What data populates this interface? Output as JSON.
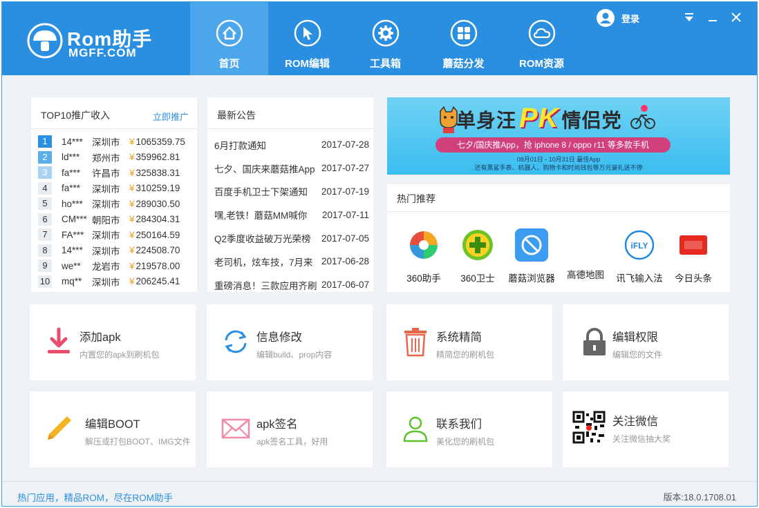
{
  "header": {
    "logo_text": "Rom助手",
    "logo_sub": "MGFF.COM",
    "nav": [
      {
        "label": "首页",
        "icon": "home-icon",
        "active": true
      },
      {
        "label": "ROM编辑",
        "icon": "cursor-icon",
        "active": false
      },
      {
        "label": "工具箱",
        "icon": "gear-icon",
        "active": false
      },
      {
        "label": "蘑菇分发",
        "icon": "grid-icon",
        "active": false
      },
      {
        "label": "ROM资源",
        "icon": "cloud-icon",
        "active": false
      }
    ],
    "login_label": "登录"
  },
  "top10": {
    "title": "TOP10推广收入",
    "link": "立即推广",
    "rows": [
      {
        "rank": "1",
        "user": "14***",
        "city": "深圳市",
        "amount": "1065359.75"
      },
      {
        "rank": "2",
        "user": "ld***",
        "city": "郑州市",
        "amount": "359962.81"
      },
      {
        "rank": "3",
        "user": "fa***",
        "city": "许昌市",
        "amount": "325838.31"
      },
      {
        "rank": "4",
        "user": "fa***",
        "city": "深圳市",
        "amount": "310259.19"
      },
      {
        "rank": "5",
        "user": "ho***",
        "city": "深圳市",
        "amount": "289030.50"
      },
      {
        "rank": "6",
        "user": "CM***",
        "city": "朝阳市",
        "amount": "284304.31"
      },
      {
        "rank": "7",
        "user": "FA***",
        "city": "深圳市",
        "amount": "250164.59"
      },
      {
        "rank": "8",
        "user": "14***",
        "city": "深圳市",
        "amount": "224508.70"
      },
      {
        "rank": "9",
        "user": "we**",
        "city": "龙岩市",
        "amount": "219578.00"
      },
      {
        "rank": "10",
        "user": "mq**",
        "city": "深圳市",
        "amount": "206245.41"
      }
    ],
    "currency": "¥"
  },
  "notices": {
    "title": "最新公告",
    "rows": [
      {
        "title": "6月打款通知",
        "date": "2017-07-28"
      },
      {
        "title": "七夕、国庆来蘑菇推App",
        "date": "2017-07-27"
      },
      {
        "title": "百度手机卫士下架通知",
        "date": "2017-07-19"
      },
      {
        "title": "嘿,老铁！蘑菇MM喊你",
        "date": "2017-07-11"
      },
      {
        "title": "Q2季度收益破万光荣榜",
        "date": "2017-07-05"
      },
      {
        "title": "老司机，炫车技，7月来",
        "date": "2017-06-28"
      },
      {
        "title": "重磅消息！三款应用齐刷",
        "date": "2017-06-07"
      }
    ]
  },
  "banner": {
    "title_left": "单身汪",
    "title_pk": "PK",
    "title_right": "情侣党",
    "strip": "七夕/国庆推App，抢 iphone 8 / oppo r11 等多款手机",
    "sub_line1": "08月01日 - 10月31日  最佳App",
    "sub_line2": "还有黑鲨手表、机器人、购物卡和时尚钱包等万元豪礼送不停"
  },
  "hot": {
    "title": "热门推荐",
    "apps": [
      {
        "label": "360助手",
        "icon": "360-assistant-icon"
      },
      {
        "label": "360卫士",
        "icon": "360-guard-icon"
      },
      {
        "label": "蘑菇浏览器",
        "icon": "mogu-browser-icon"
      },
      {
        "label": "高德地图",
        "icon": "amap-icon"
      },
      {
        "label": "讯飞输入法",
        "icon": "ifly-icon"
      },
      {
        "label": "今日头条",
        "icon": "toutiao-icon"
      }
    ]
  },
  "tiles": [
    {
      "title": "添加apk",
      "desc": "内置您的apk到刷机包",
      "icon": "download-icon"
    },
    {
      "title": "信息修改",
      "desc": "编辑build、prop内容",
      "icon": "refresh-icon"
    },
    {
      "title": "系统精简",
      "desc": "精简您的刷机包",
      "icon": "trash-icon"
    },
    {
      "title": "编辑权限",
      "desc": "编辑您的文件",
      "icon": "lock-icon"
    },
    {
      "title": "编辑BOOT",
      "desc": "解压或打包BOOT、IMG文件",
      "icon": "pencil-icon"
    },
    {
      "title": "apk签名",
      "desc": "apk签名工具，好用",
      "icon": "envelope-icon"
    },
    {
      "title": "联系我们",
      "desc": "美化您的刷机包",
      "icon": "user-icon"
    },
    {
      "title": "关注微信",
      "desc": "关注微信抽大奖",
      "icon": "qrcode-icon"
    }
  ],
  "footer": {
    "left": "热门应用，精品ROM，尽在ROM助手",
    "right": "版本:18.0.1708.01"
  },
  "colors": {
    "accent": "#2a8fe0",
    "nav_active": "#4ba6ec",
    "page_bg": "#eef2f7",
    "yen": "#f0a020"
  }
}
